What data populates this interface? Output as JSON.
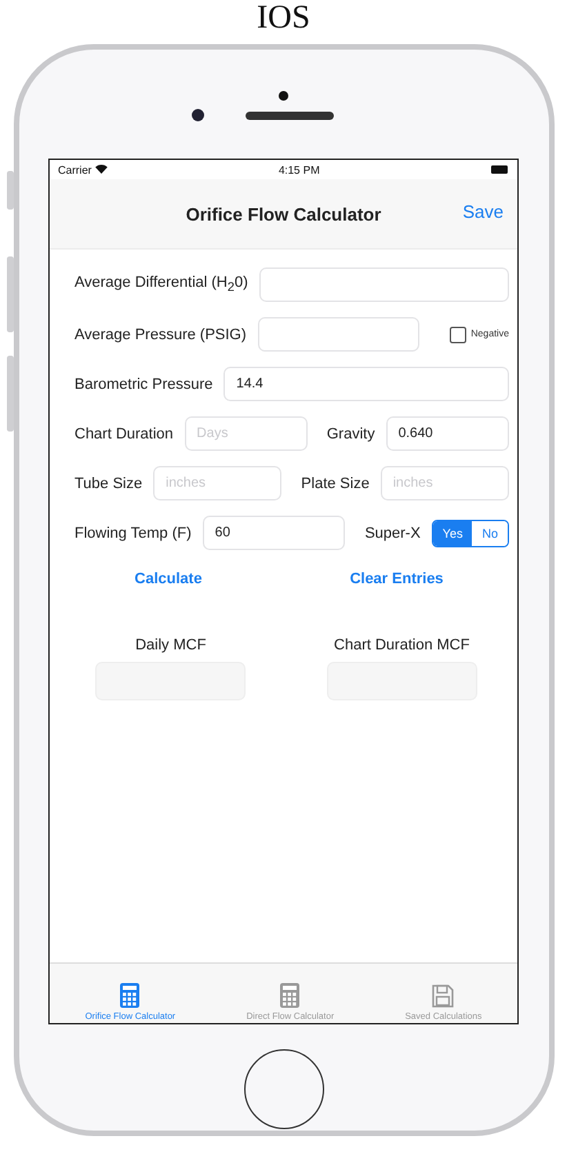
{
  "caption": "IOS",
  "status_bar": {
    "carrier": "Carrier",
    "time": "4:15 PM"
  },
  "nav_bar": {
    "title": "Orifice Flow Calculator",
    "action": "Save"
  },
  "form_rows": [
    {
      "items": [
        {
          "kind": "input",
          "label": "Average Differential (H$_{2}$0)"
        }
      ]
    },
    {
      "items": [
        {
          "kind": "input",
          "label": "Average Pressure (PSIG)"
        },
        {
          "kind": "checkbox",
          "label": "Negative",
          "checked": false
        }
      ]
    },
    {
      "items": [
        {
          "kind": "input",
          "label": "Barometric Pressure",
          "value": "14.4"
        }
      ]
    },
    {
      "items": [
        {
          "kind": "input",
          "label": "Chart Duration",
          "placeholder": "Days"
        },
        {
          "kind": "input",
          "label": "Gravity",
          "value": "0.640"
        }
      ]
    },
    {
      "items": [
        {
          "kind": "input",
          "label": "Tube Size",
          "placeholder": "inches"
        },
        {
          "kind": "input",
          "label": "Plate Size",
          "placeholder": "inches"
        }
      ]
    },
    {
      "items": [
        {
          "kind": "input",
          "label": "Flowing Temp (F)",
          "value": "60"
        },
        {
          "kind": "segmented",
          "label": "Super-X",
          "options": [
            {
              "label": "Yes",
              "selected": true
            },
            {
              "label": "No",
              "selected": false
            }
          ]
        }
      ]
    }
  ],
  "actions": [
    "Calculate",
    "Clear Entries"
  ],
  "results": [
    {
      "label": "Daily MCF"
    },
    {
      "label": "Chart Duration MCF"
    }
  ],
  "tabs": [
    {
      "kind": "calculator",
      "label": "Orifice Flow Calculator",
      "selected": true
    },
    {
      "kind": "calculator",
      "label": "Direct Flow Calculator",
      "selected": false
    },
    {
      "kind": "disk",
      "label": "Saved Calculations",
      "selected": false
    }
  ]
}
